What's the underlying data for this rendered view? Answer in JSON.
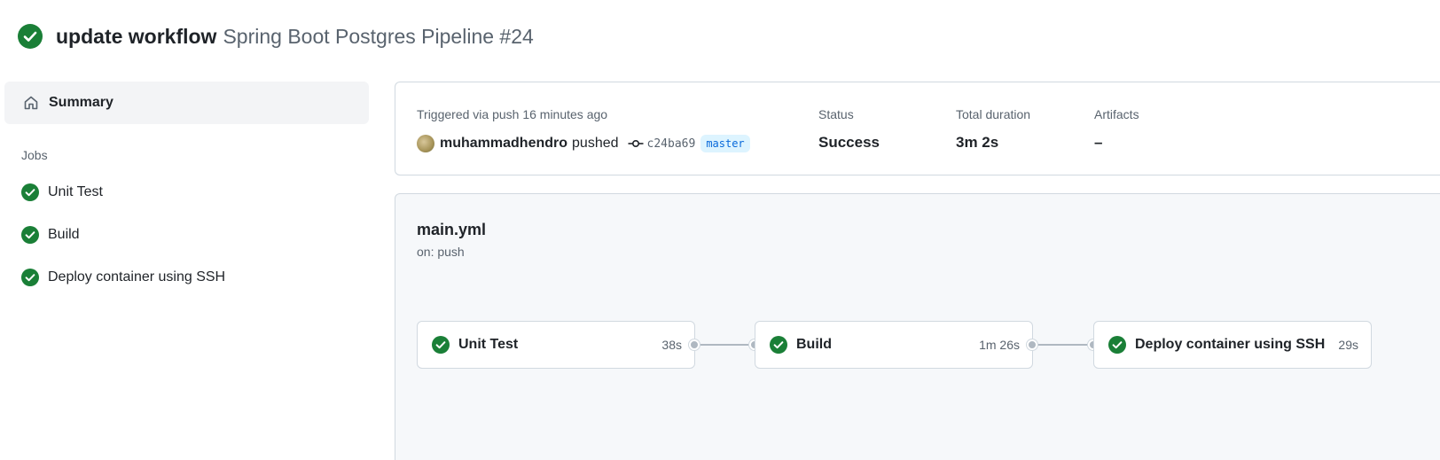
{
  "header": {
    "title": "update workflow",
    "subtitle": "Spring Boot Postgres Pipeline #24",
    "status_icon": "check-circle-fill-icon"
  },
  "sidebar": {
    "summary_label": "Summary",
    "summary_icon": "home-icon",
    "jobs_heading": "Jobs",
    "jobs": [
      {
        "label": "Unit Test",
        "icon": "check-circle-fill-icon"
      },
      {
        "label": "Build",
        "icon": "check-circle-fill-icon"
      },
      {
        "label": "Deploy container using SSH",
        "icon": "check-circle-fill-icon"
      }
    ]
  },
  "run_info": {
    "trigger_text": "Triggered via push 16 minutes ago",
    "actor": "muhammadhendro",
    "action": "pushed",
    "commit_sha": "c24ba69",
    "branch": "master",
    "status_label": "Status",
    "status_value": "Success",
    "duration_label": "Total duration",
    "duration_value": "3m 2s",
    "artifacts_label": "Artifacts",
    "artifacts_value": "–"
  },
  "workflow": {
    "file": "main.yml",
    "trigger": "on: push",
    "jobs": [
      {
        "name": "Unit Test",
        "duration": "38s"
      },
      {
        "name": "Build",
        "duration": "1m 26s"
      },
      {
        "name": "Deploy container using SSH",
        "duration": "29s"
      }
    ]
  },
  "colors": {
    "success": "#1a7f37",
    "branch_bg": "#ddf4ff",
    "branch_text": "#0969da",
    "muted": "#59636e"
  }
}
